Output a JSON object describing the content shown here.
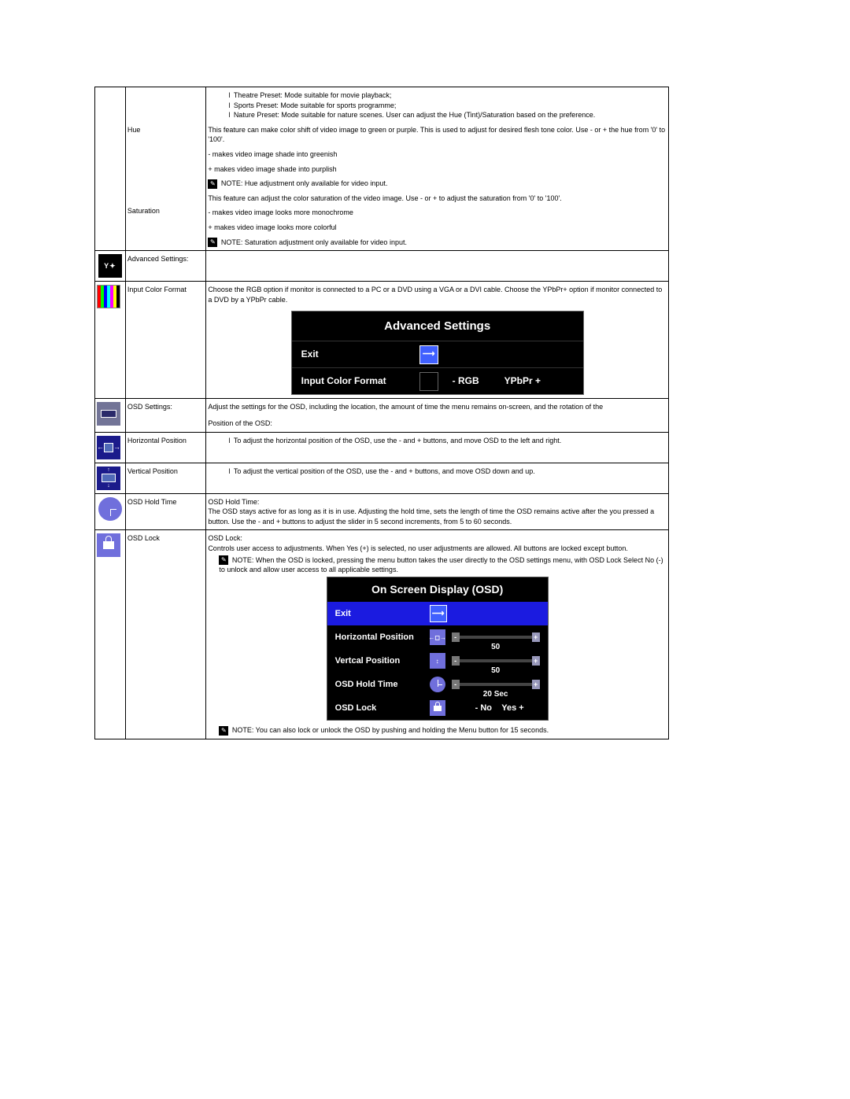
{
  "presets": {
    "theatre": "Theatre Preset: Mode suitable for movie playback;",
    "sports": "Sports Preset: Mode suitable for sports programme;",
    "nature": "Nature Preset: Mode suitable for nature scenes. User can adjust the Hue (Tint)/Saturation based on the preference."
  },
  "hue": {
    "label": "Hue",
    "desc": "This feature can make color shift of video image to green or purple. This is used to adjust for desired flesh tone color. Use - or + the hue from '0' to '100'.",
    "minus": "- makes video image shade into greenish",
    "plus": "+ makes video image shade into purplish",
    "note": "NOTE: Hue adjustment only available for video input."
  },
  "saturation": {
    "label": "Saturation",
    "desc": "This feature can adjust the color saturation of the video image. Use - or +  to adjust the saturation from '0' to '100'.",
    "minus": "- makes video image looks more monochrome",
    "plus": "+ makes video image looks more colorful",
    "note": "NOTE: Saturation adjustment only available for video input."
  },
  "advanced": {
    "label": "Advanced Settings:",
    "panel_title": "Advanced Settings",
    "exit": "Exit",
    "icf_label": "Input Color Format",
    "rgb": "- RGB",
    "ypbpr": "YPbPr +"
  },
  "input_color": {
    "label": "Input Color Format",
    "desc": "Choose the RGB option if monitor is connected to a PC or a DVD using a VGA or a DVI cable. Choose the YPbPr+ option if monitor connected to a DVD by a YPbPr cable."
  },
  "osd_settings": {
    "label": "OSD Settings:",
    "desc": "Adjust the settings for the OSD, including the location, the amount of time the menu remains on-screen, and the rotation of the",
    "pos_heading": "Position of the OSD:"
  },
  "hpos": {
    "label": "Horizontal Position",
    "desc": "To adjust the horizontal position of the OSD, use the - and + buttons, and move OSD to the left and right."
  },
  "vpos": {
    "label": "Vertical Position",
    "desc": "To adjust the vertical position of the OSD, use the - and + buttons, and move OSD down and up."
  },
  "hold": {
    "label": "OSD Hold Time",
    "heading": "OSD Hold Time:",
    "desc": "The OSD stays active for as long as it is in use. Adjusting the hold time, sets the length of time the OSD remains active after the you pressed a button. Use the - and + buttons to adjust the slider in 5 second increments, from 5 to 60 seconds."
  },
  "lock": {
    "label": "OSD Lock",
    "heading": "OSD Lock:",
    "desc": "Controls user access to adjustments. When Yes (+) is selected, no user adjustments are allowed. All buttons are locked except button.",
    "note1": "NOTE: When the OSD is locked, pressing the menu button takes the user directly to the OSD settings menu, with OSD Lock Select No (-) to unlock and allow user access to all applicable settings.",
    "note2": "NOTE: You can also lock or unlock the OSD by pushing and holding the Menu button for 15 seconds."
  },
  "osd_panel": {
    "title": "On Screen Display (OSD)",
    "exit": "Exit",
    "hpos": "Horizontal Position",
    "vpos": "Vertcal Position",
    "hold": "OSD Hold Time",
    "lock": "OSD Lock",
    "v50": "50",
    "v20": "20 Sec",
    "no": "- No",
    "yes": "Yes +"
  }
}
